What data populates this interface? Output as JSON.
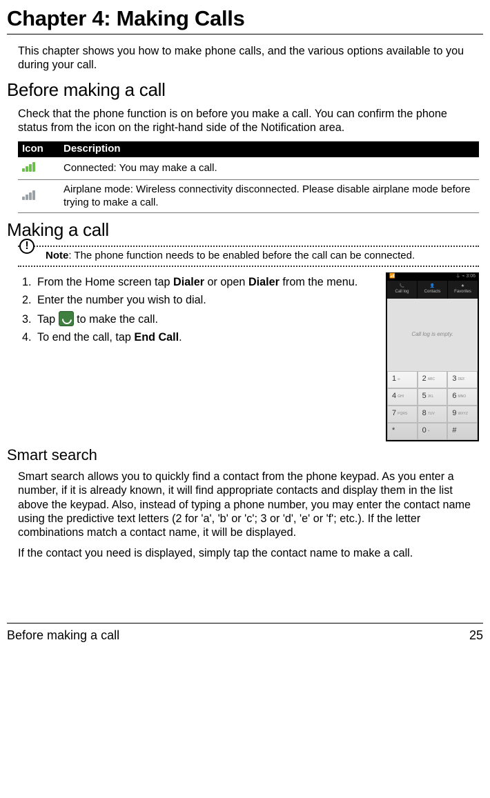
{
  "chapter": {
    "title": "Chapter 4: Making Calls"
  },
  "intro": "This chapter shows you how to make phone calls, and the various options available to you during your call.",
  "section_before": {
    "heading": "Before making a call",
    "text": "Check that the phone function is on before you make a call. You can confirm the phone status from the icon on the right-hand side of the Notification area."
  },
  "icon_table": {
    "headers": {
      "icon": "Icon",
      "desc": "Description"
    },
    "rows": [
      {
        "desc": "Connected: You may make a call."
      },
      {
        "desc": "Airplane mode: Wireless connectivity disconnected. Please disable airplane mode before trying to make a call."
      }
    ]
  },
  "section_making": {
    "heading": "Making a call",
    "note_label": "Note",
    "note_text": ": The phone function needs to be enabled before the call can be connected.",
    "steps": {
      "s1a": "From the Home screen tap ",
      "s1b": "Dialer",
      "s1c": " or open ",
      "s1d": "Dialer",
      "s1e": " from the menu.",
      "s2": "Enter the number you wish to dial.",
      "s3a": "Tap ",
      "s3b": " to make the call.",
      "s4a": "To end the call, tap ",
      "s4b": "End Call",
      "s4c": "."
    }
  },
  "phone": {
    "status_left": "📶",
    "status_right": "⏚ ⌁ 3:06",
    "tabs": [
      "Call log",
      "Contacts",
      "Favorites"
    ],
    "mid_text": "Call log is empty.",
    "keys": [
      "1",
      "2",
      "3",
      "4",
      "5",
      "6",
      "7",
      "8",
      "9",
      "*",
      "0",
      "#"
    ],
    "subs": [
      "∞",
      "ABC",
      "DEF",
      "GHI",
      "JKL",
      "MNO",
      "PQRS",
      "TUV",
      "WXYZ",
      "",
      "+",
      ""
    ]
  },
  "section_smart": {
    "heading": "Smart search",
    "p1": "Smart search allows you to quickly find a contact from the phone keypad. As you enter a number, if it is already known, it will find appropriate contacts and display them in the list above the keypad. Also, instead of typing a phone number, you may enter the contact name using the predictive text letters (2 for 'a', 'b' or 'c'; 3 or 'd', 'e' or 'f'; etc.). If the letter combinations match a contact name, it will be displayed.",
    "p2": "If the contact you need is displayed, simply tap the contact name to make a call."
  },
  "footer": {
    "left": "Before making a call",
    "right": "25"
  }
}
